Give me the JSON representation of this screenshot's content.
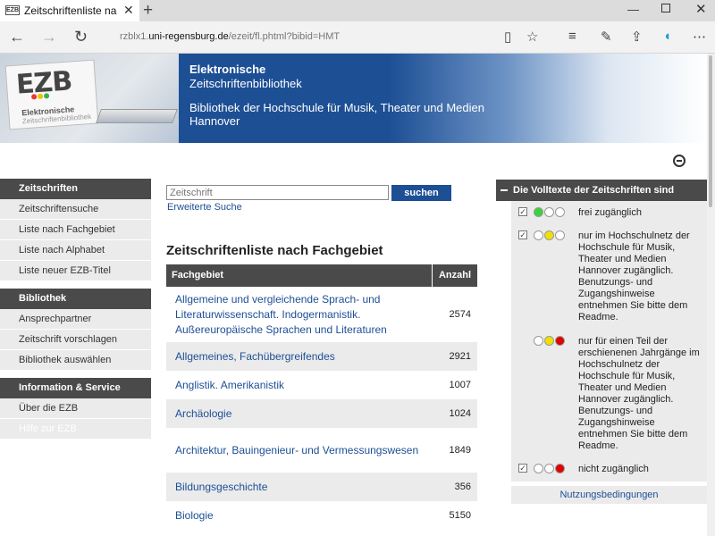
{
  "browser": {
    "tab_title": "Zeitschriftenliste nach F",
    "tab_favicon": "EZB",
    "url_prefix": "rzblx1.",
    "url_domain": "uni-regensburg.de",
    "url_path": "/ezeit/fl.phtml?bibid=HMT"
  },
  "banner": {
    "logo_mark": "EZB",
    "logo_line1": "Elektronische",
    "logo_line2": "Zeitschriftenbibliothek",
    "title": "Elektronische",
    "subtitle": "Zeitschriftenbibliothek",
    "library": "Bibliothek der Hochschule für Musik, Theater und Medien Hannover"
  },
  "sidebar": {
    "sections": [
      {
        "heading": "Zeitschriften",
        "items": [
          "Zeitschriftensuche",
          "Liste nach Fachgebiet",
          "Liste nach Alphabet",
          "Liste neuer EZB-Titel"
        ]
      },
      {
        "heading": "Bibliothek",
        "items": [
          "Ansprechpartner",
          "Zeitschrift vorschlagen",
          "Bibliothek auswählen"
        ]
      },
      {
        "heading": "Information & Service",
        "items": [
          "Über die EZB",
          "Hilfe zur EZB"
        ]
      }
    ]
  },
  "search": {
    "placeholder": "Zeitschrift",
    "button": "suchen",
    "advanced": "Erweiterte Suche"
  },
  "main": {
    "heading": "Zeitschriftenliste nach Fachgebiet",
    "columns": [
      "Fachgebiet",
      "Anzahl"
    ],
    "rows": [
      {
        "name": "Allgemeine und vergleichende Sprach- und Literaturwissenschaft. Indogermanistik. Außereuropäische Sprachen und Literaturen",
        "count": "2574"
      },
      {
        "name": "Allgemeines, Fachübergreifendes",
        "count": "2921"
      },
      {
        "name": "Anglistik. Amerikanistik",
        "count": "1007"
      },
      {
        "name": "Archäologie",
        "count": "1024"
      },
      {
        "name": "Architektur, Bauingenieur- und Vermessungswesen",
        "count": "1849"
      },
      {
        "name": "Bildungsgeschichte",
        "count": "356"
      },
      {
        "name": "Biologie",
        "count": "5150"
      }
    ]
  },
  "legend": {
    "heading": "Die Volltexte der Zeitschriften sind",
    "items": [
      {
        "text": "frei zugänglich",
        "lights": [
          "#3ad23a",
          "#ffffff",
          "#ffffff"
        ]
      },
      {
        "text": "nur im Hochschulnetz der Hochschule für Musik, Theater und Medien Hannover zugänglich. Benutzungs- und Zugangshinweise entnehmen Sie bitte dem Readme.",
        "lights": [
          "#ffffff",
          "#f0e000",
          "#ffffff"
        ]
      },
      {
        "text": "nur für einen Teil der erschienenen Jahrgänge im Hochschulnetz der Hochschule für Musik, Theater und Medien Hannover zugänglich. Benutzungs- und Zugangshinweise entnehmen Sie bitte dem Readme.",
        "lights": [
          "#ffffff",
          "#f0e000",
          "#e00000"
        ]
      },
      {
        "text": "nicht zugänglich",
        "lights": [
          "#ffffff",
          "#ffffff",
          "#e00000"
        ]
      }
    ],
    "terms": "Nutzungsbedingungen"
  },
  "colors": {
    "accent": "#1d4f95",
    "header_dark": "#4a4a4a",
    "row_alt": "#ebebeb"
  }
}
